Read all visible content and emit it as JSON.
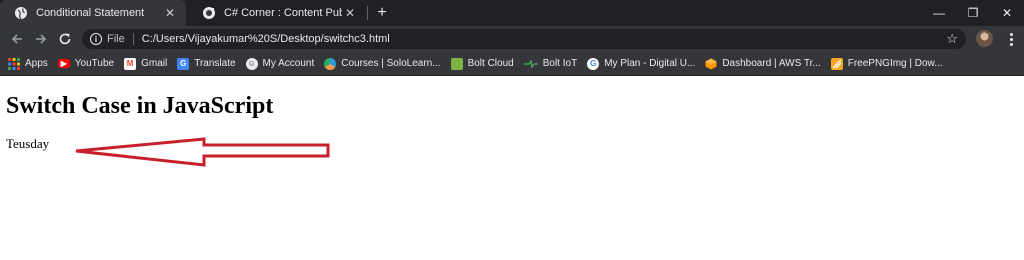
{
  "browser": {
    "tabs": [
      {
        "title": "Conditional Statement",
        "active": true,
        "icon": "globe-icon"
      },
      {
        "title": "C# Corner : Content Publisher",
        "active": false,
        "icon": "csharp-corner-icon"
      }
    ],
    "new_tab_label": "+",
    "window_controls": {
      "minimize": "—",
      "restore": "❐",
      "close": "✕"
    },
    "address_bar": {
      "scheme_label": "File",
      "url": "C:/Users/Vijayakumar%20S/Desktop/switchc3.html"
    }
  },
  "bookmarks": [
    {
      "label": "Apps",
      "icon": "apps-grid-icon"
    },
    {
      "label": "YouTube",
      "icon": "youtube-icon",
      "color": "#ff0000"
    },
    {
      "label": "Gmail",
      "icon": "gmail-icon",
      "color": "#ea4335"
    },
    {
      "label": "Translate",
      "icon": "translate-icon",
      "color": "#4285f4"
    },
    {
      "label": "My Account",
      "icon": "account-icon"
    },
    {
      "label": "Courses | SoloLearn...",
      "icon": "sololearn-icon"
    },
    {
      "label": "Bolt Cloud",
      "icon": "bolt-cloud-icon",
      "color": "#7cb342"
    },
    {
      "label": "Bolt IoT",
      "icon": "bolt-iot-icon",
      "color": "#4caf50"
    },
    {
      "label": "My Plan - Digital U...",
      "icon": "google-icon"
    },
    {
      "label": "Dashboard | AWS Tr...",
      "icon": "aws-icon",
      "color": "#ff9900"
    },
    {
      "label": "FreePNGImg | Dow...",
      "icon": "freepngimg-icon",
      "color": "#f5a623"
    }
  ],
  "page": {
    "heading": "Switch Case in JavaScript",
    "output": "Teusday",
    "annotation_color": "#c8202b"
  }
}
